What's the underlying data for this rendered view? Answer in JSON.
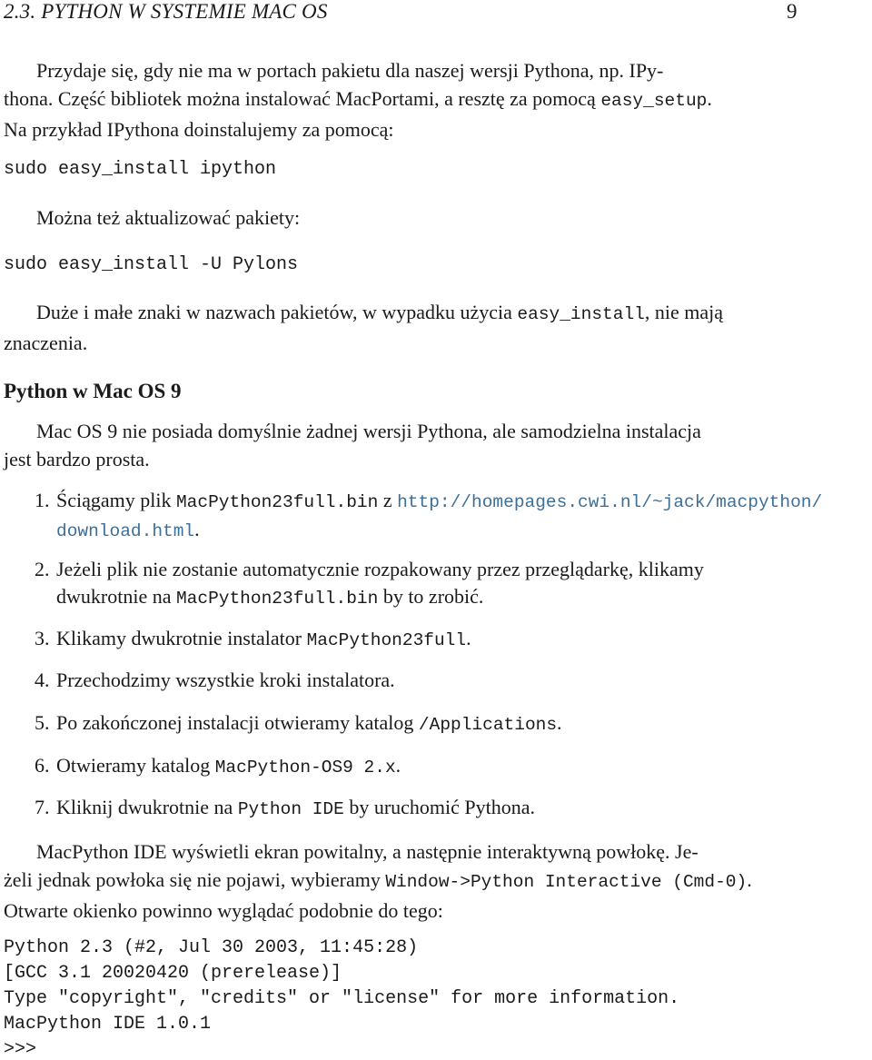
{
  "header": {
    "section_title": "2.3.  PYTHON W SYSTEMIE MAC OS",
    "page_number": "9"
  },
  "intro": {
    "line1": "Przydaje się, gdy nie ma w portach pakietu dla naszej wersji Pythona, np. IPy-",
    "line2_pre": "thona. Część bibliotek można instalować MacPortami, a resztę za pomocą ",
    "line2_code": "easy_setup",
    "line2_post": ".",
    "line3": "Na przykład IPythona doinstalujemy za pomocą:"
  },
  "code1": "sudo easy_install ipython",
  "para_update": "Można też aktualizować pakiety:",
  "code2": "sudo easy_install -U Pylons",
  "para_case": {
    "pre": "Duże i małe znaki w nazwach pakietów, w wypadku użycia ",
    "code": "easy_install",
    "post": ", nie mają",
    "line2": "znaczenia."
  },
  "section": {
    "heading": "Python w Mac OS 9",
    "intro_line1": "Mac OS 9 nie posiada domyślnie żadnej wersji Pythona, ale samodzielna instalacja",
    "intro_line2": "jest bardzo prosta."
  },
  "steps": [
    {
      "num": "1.",
      "pre": "Ściągamy plik ",
      "code": "MacPython23full.bin",
      "mid": " z ",
      "link_line1": "http://homepages.cwi.nl/~jack/macpython/",
      "link_line2": "download.html",
      "post": "."
    },
    {
      "num": "2.",
      "line1": "Jeżeli plik nie zostanie automatycznie rozpakowany przez przeglądarkę, klikamy",
      "pre": "dwukrotnie na ",
      "code": "MacPython23full.bin",
      "post": " by to zrobić."
    },
    {
      "num": "3.",
      "pre": "Klikamy dwukrotnie instalator ",
      "code": "MacPython23full",
      "post": "."
    },
    {
      "num": "4.",
      "pre": "Przechodzimy wszystkie kroki instalatora.",
      "code": "",
      "post": ""
    },
    {
      "num": "5.",
      "pre": "Po zakończonej instalacji otwieramy katalog ",
      "code": "/Applications",
      "post": "."
    },
    {
      "num": "6.",
      "pre": "Otwieramy katalog ",
      "code": "MacPython-OS9 2.x",
      "post": "."
    },
    {
      "num": "7.",
      "pre": "Kliknij dwukrotnie na ",
      "code": "Python IDE",
      "post": " by uruchomić Pythona."
    }
  ],
  "closing": {
    "line1": "MacPython IDE wyświetli ekran powitalny, a następnie interaktywną powłokę. Je-",
    "line2_pre": "żeli jednak powłoka się nie pojawi, wybieramy ",
    "line2_code": "Window->Python Interactive (Cmd-0)",
    "line2_post": ".",
    "line3": "Otwarte okienko powinno wyglądać podobnie do tego:"
  },
  "console": [
    "Python 2.3 (#2, Jul 30 2003, 11:45:28)",
    "[GCC 3.1 20020420 (prerelease)]",
    "Type \"copyright\", \"credits\" or \"license\" for more information.",
    "MacPython IDE 1.0.1",
    ">>>"
  ],
  "colors": {
    "link": "#3e6f98",
    "text": "#1a1a1a"
  }
}
